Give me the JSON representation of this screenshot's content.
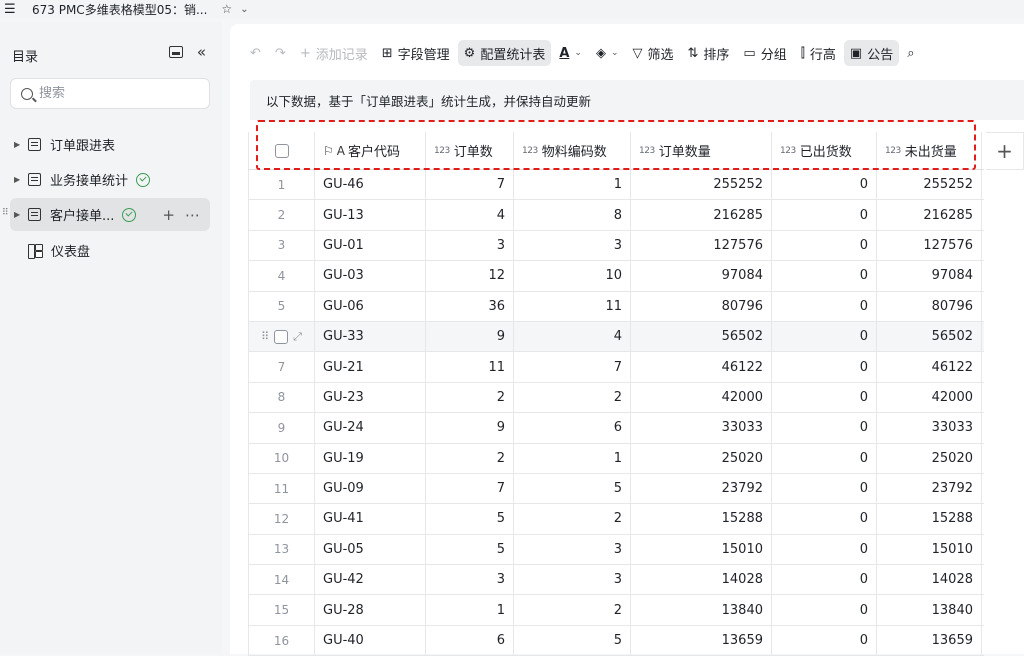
{
  "titlebar": {
    "title": "673 PMC多维表格模型05：销..."
  },
  "sidebar": {
    "title": "目录",
    "search_placeholder": "搜索",
    "items": [
      {
        "label": "订单跟进表",
        "icon": "table-icon",
        "synced": false
      },
      {
        "label": "业务接单统计",
        "icon": "table-icon",
        "synced": true
      },
      {
        "label": "客户接单...",
        "icon": "table-icon",
        "synced": true,
        "active": true
      },
      {
        "label": "仪表盘",
        "icon": "dashboard-icon",
        "synced": false
      }
    ]
  },
  "toolbar": {
    "add_record": "添加记录",
    "field_manage": "字段管理",
    "config_stats": "配置统计表",
    "filter": "筛选",
    "sort": "排序",
    "group": "分组",
    "row_height": "行高",
    "notice": "公告"
  },
  "notice_text": "以下数据，基于「订单跟进表」统计生成，并保持自动更新",
  "table": {
    "columns": [
      {
        "label": "客户代码",
        "type": "text"
      },
      {
        "label": "订单数",
        "type": "number"
      },
      {
        "label": "物料编码数",
        "type": "number"
      },
      {
        "label": "订单数量",
        "type": "number"
      },
      {
        "label": "已出货数",
        "type": "number"
      },
      {
        "label": "未出货量",
        "type": "number"
      }
    ],
    "rows": [
      {
        "n": "1",
        "cells": [
          "GU-46",
          "7",
          "1",
          "255252",
          "0",
          "255252"
        ]
      },
      {
        "n": "2",
        "cells": [
          "GU-13",
          "4",
          "8",
          "216285",
          "0",
          "216285"
        ]
      },
      {
        "n": "3",
        "cells": [
          "GU-01",
          "3",
          "3",
          "127576",
          "0",
          "127576"
        ]
      },
      {
        "n": "4",
        "cells": [
          "GU-03",
          "12",
          "10",
          "97084",
          "0",
          "97084"
        ]
      },
      {
        "n": "5",
        "cells": [
          "GU-06",
          "36",
          "11",
          "80796",
          "0",
          "80796"
        ]
      },
      {
        "n": "6",
        "cells": [
          "GU-33",
          "9",
          "4",
          "56502",
          "0",
          "56502"
        ],
        "hover": true
      },
      {
        "n": "7",
        "cells": [
          "GU-21",
          "11",
          "7",
          "46122",
          "0",
          "46122"
        ]
      },
      {
        "n": "8",
        "cells": [
          "GU-23",
          "2",
          "2",
          "42000",
          "0",
          "42000"
        ]
      },
      {
        "n": "9",
        "cells": [
          "GU-24",
          "9",
          "6",
          "33033",
          "0",
          "33033"
        ]
      },
      {
        "n": "10",
        "cells": [
          "GU-19",
          "2",
          "1",
          "25020",
          "0",
          "25020"
        ]
      },
      {
        "n": "11",
        "cells": [
          "GU-09",
          "7",
          "5",
          "23792",
          "0",
          "23792"
        ]
      },
      {
        "n": "12",
        "cells": [
          "GU-41",
          "5",
          "2",
          "15288",
          "0",
          "15288"
        ]
      },
      {
        "n": "13",
        "cells": [
          "GU-05",
          "5",
          "3",
          "15010",
          "0",
          "15010"
        ]
      },
      {
        "n": "14",
        "cells": [
          "GU-42",
          "3",
          "3",
          "14028",
          "0",
          "14028"
        ]
      },
      {
        "n": "15",
        "cells": [
          "GU-28",
          "1",
          "2",
          "13840",
          "0",
          "13840"
        ]
      },
      {
        "n": "16",
        "cells": [
          "GU-40",
          "6",
          "5",
          "13659",
          "0",
          "13659"
        ]
      }
    ]
  },
  "colors": {
    "highlight": "#e21b1b",
    "sync_green": "#3a9d53"
  }
}
